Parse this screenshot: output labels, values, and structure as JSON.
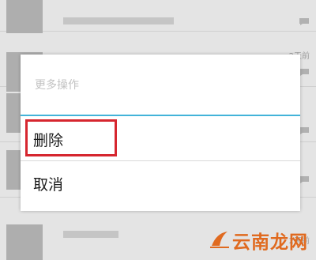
{
  "background_list": {
    "rows": [
      {
        "time": "",
        "has_chat_icon": true
      },
      {
        "time": "2天前",
        "has_chat_icon": true
      },
      {
        "time": "",
        "has_chat_icon": true
      },
      {
        "time": "",
        "has_chat_icon": true
      },
      {
        "time": "2天前",
        "has_chat_icon": false
      }
    ]
  },
  "dialog": {
    "title": "更多操作",
    "items": [
      {
        "label": "删除"
      },
      {
        "label": "取消"
      }
    ]
  },
  "colors": {
    "accent_divider": "#43b3d9",
    "highlight": "#d6262f",
    "watermark": "#e06a1f"
  },
  "watermark": {
    "text": "云南龙网"
  }
}
